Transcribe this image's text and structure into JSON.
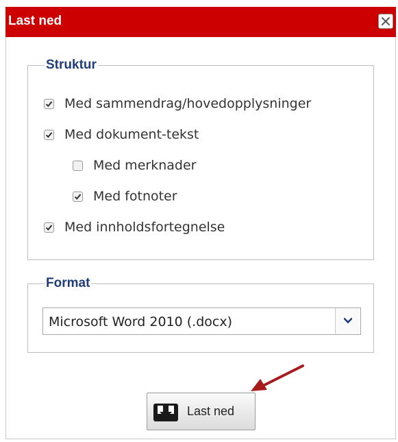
{
  "dialog": {
    "title": "Last ned",
    "colors": {
      "titlebar": "#cc0000",
      "legend": "#1f3d7a"
    }
  },
  "struktur": {
    "legend": "Struktur",
    "options": [
      {
        "label": "Med sammendrag/hovedopplysninger",
        "checked": true
      },
      {
        "label": "Med dokument-tekst",
        "checked": true
      },
      {
        "label": "Med merknader",
        "checked": false
      },
      {
        "label": "Med fotnoter",
        "checked": true
      },
      {
        "label": "Med innholdsfortegnelse",
        "checked": true
      }
    ]
  },
  "format": {
    "legend": "Format",
    "selected": "Microsoft Word 2010 (.docx)"
  },
  "actions": {
    "download_label": "Last ned"
  },
  "icons": {
    "close": "close-icon",
    "checkmark": "checkmark-icon",
    "dropdown": "chevron-down-icon",
    "download": "download-tray-icon",
    "annotation": "red-arrow-icon"
  }
}
